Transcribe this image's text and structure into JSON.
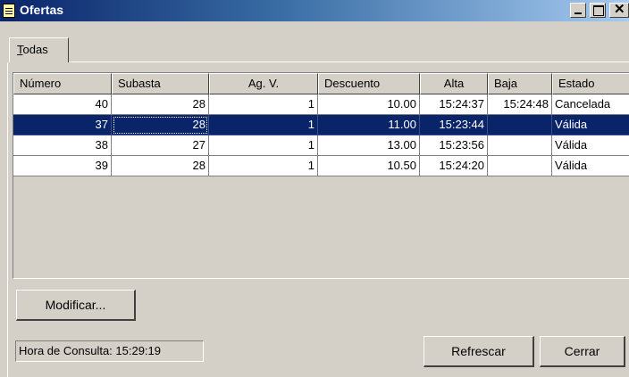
{
  "window": {
    "title": "Ofertas",
    "icon": "notepad-icon",
    "buttons": [
      "minimize-icon",
      "maximize-icon",
      "close-icon"
    ]
  },
  "tabs": [
    {
      "label": "Todas",
      "accelerator": "T",
      "rest": "odas",
      "selected": true
    }
  ],
  "table": {
    "columns": [
      "Número",
      "Subasta",
      "Ag. V.",
      "Descuento",
      "Alta",
      "Baja",
      "Estado"
    ],
    "rows": [
      {
        "numero": "40",
        "subasta": "28",
        "agv": "1",
        "descuento": "10.00",
        "alta": "15:24:37",
        "baja": "15:24:48",
        "estado": "Cancelada",
        "selected": false
      },
      {
        "numero": "37",
        "subasta": "28",
        "agv": "1",
        "descuento": "11.00",
        "alta": "15:23:44",
        "baja": "",
        "estado": "Válida",
        "selected": true
      },
      {
        "numero": "38",
        "subasta": "27",
        "agv": "1",
        "descuento": "13.00",
        "alta": "15:23:56",
        "baja": "",
        "estado": "Válida",
        "selected": false
      },
      {
        "numero": "39",
        "subasta": "28",
        "agv": "1",
        "descuento": "10.50",
        "alta": "15:24:20",
        "baja": "",
        "estado": "Válida",
        "selected": false
      }
    ]
  },
  "buttons": {
    "modify": "Modificar...",
    "refresh": "Refrescar",
    "close": "Cerrar"
  },
  "status": {
    "label": "Hora de Consulta: 15:29:19"
  },
  "colors": {
    "selection": "#0a246a",
    "face": "#d4d0c8",
    "title_start": "#0a246a",
    "title_end": "#a6caf0"
  }
}
